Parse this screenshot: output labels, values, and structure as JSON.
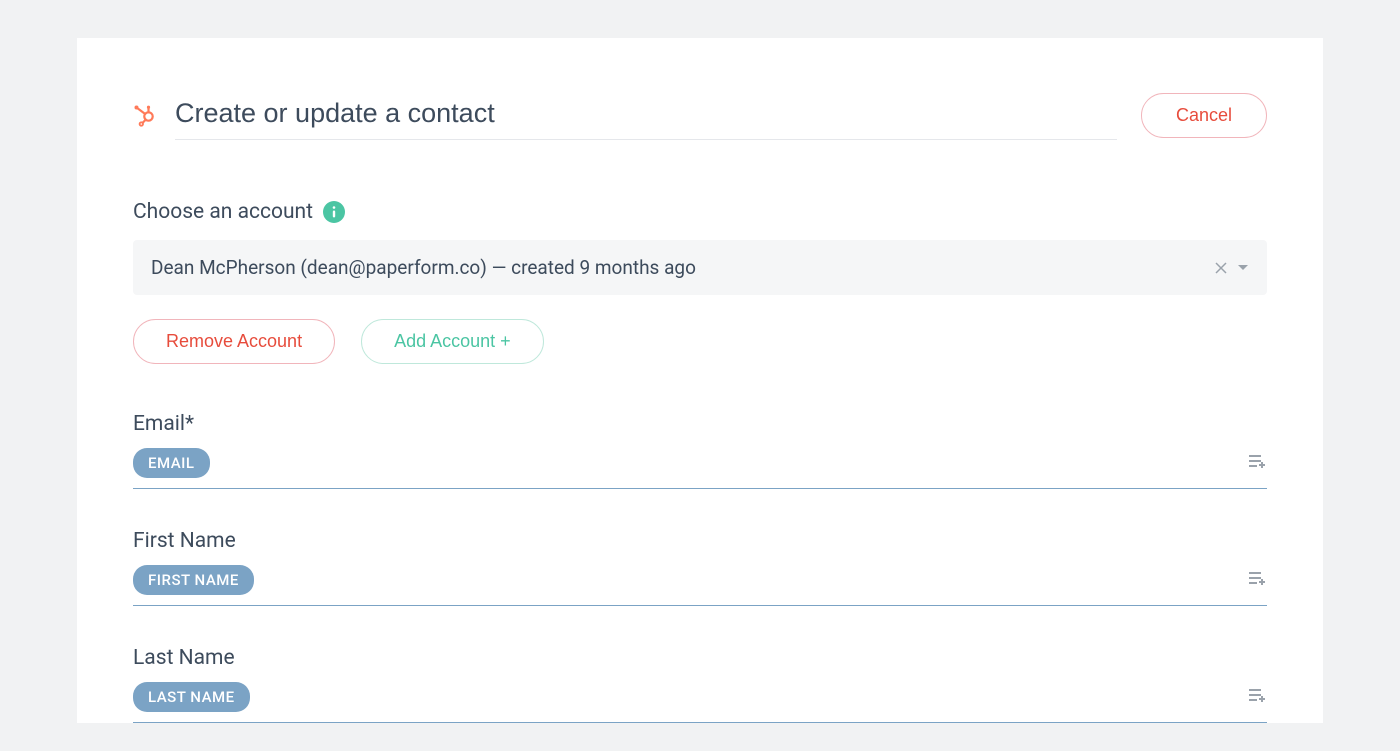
{
  "header": {
    "title": "Create or update a contact",
    "cancel_label": "Cancel"
  },
  "account": {
    "label": "Choose an account",
    "selected": "Dean McPherson (dean@paperform.co) — created 9 months ago",
    "remove_label": "Remove Account",
    "add_label": "Add Account +"
  },
  "fields": [
    {
      "label": "Email*",
      "token": "EMAIL"
    },
    {
      "label": "First Name",
      "token": "FIRST NAME"
    },
    {
      "label": "Last Name",
      "token": "LAST NAME"
    }
  ]
}
